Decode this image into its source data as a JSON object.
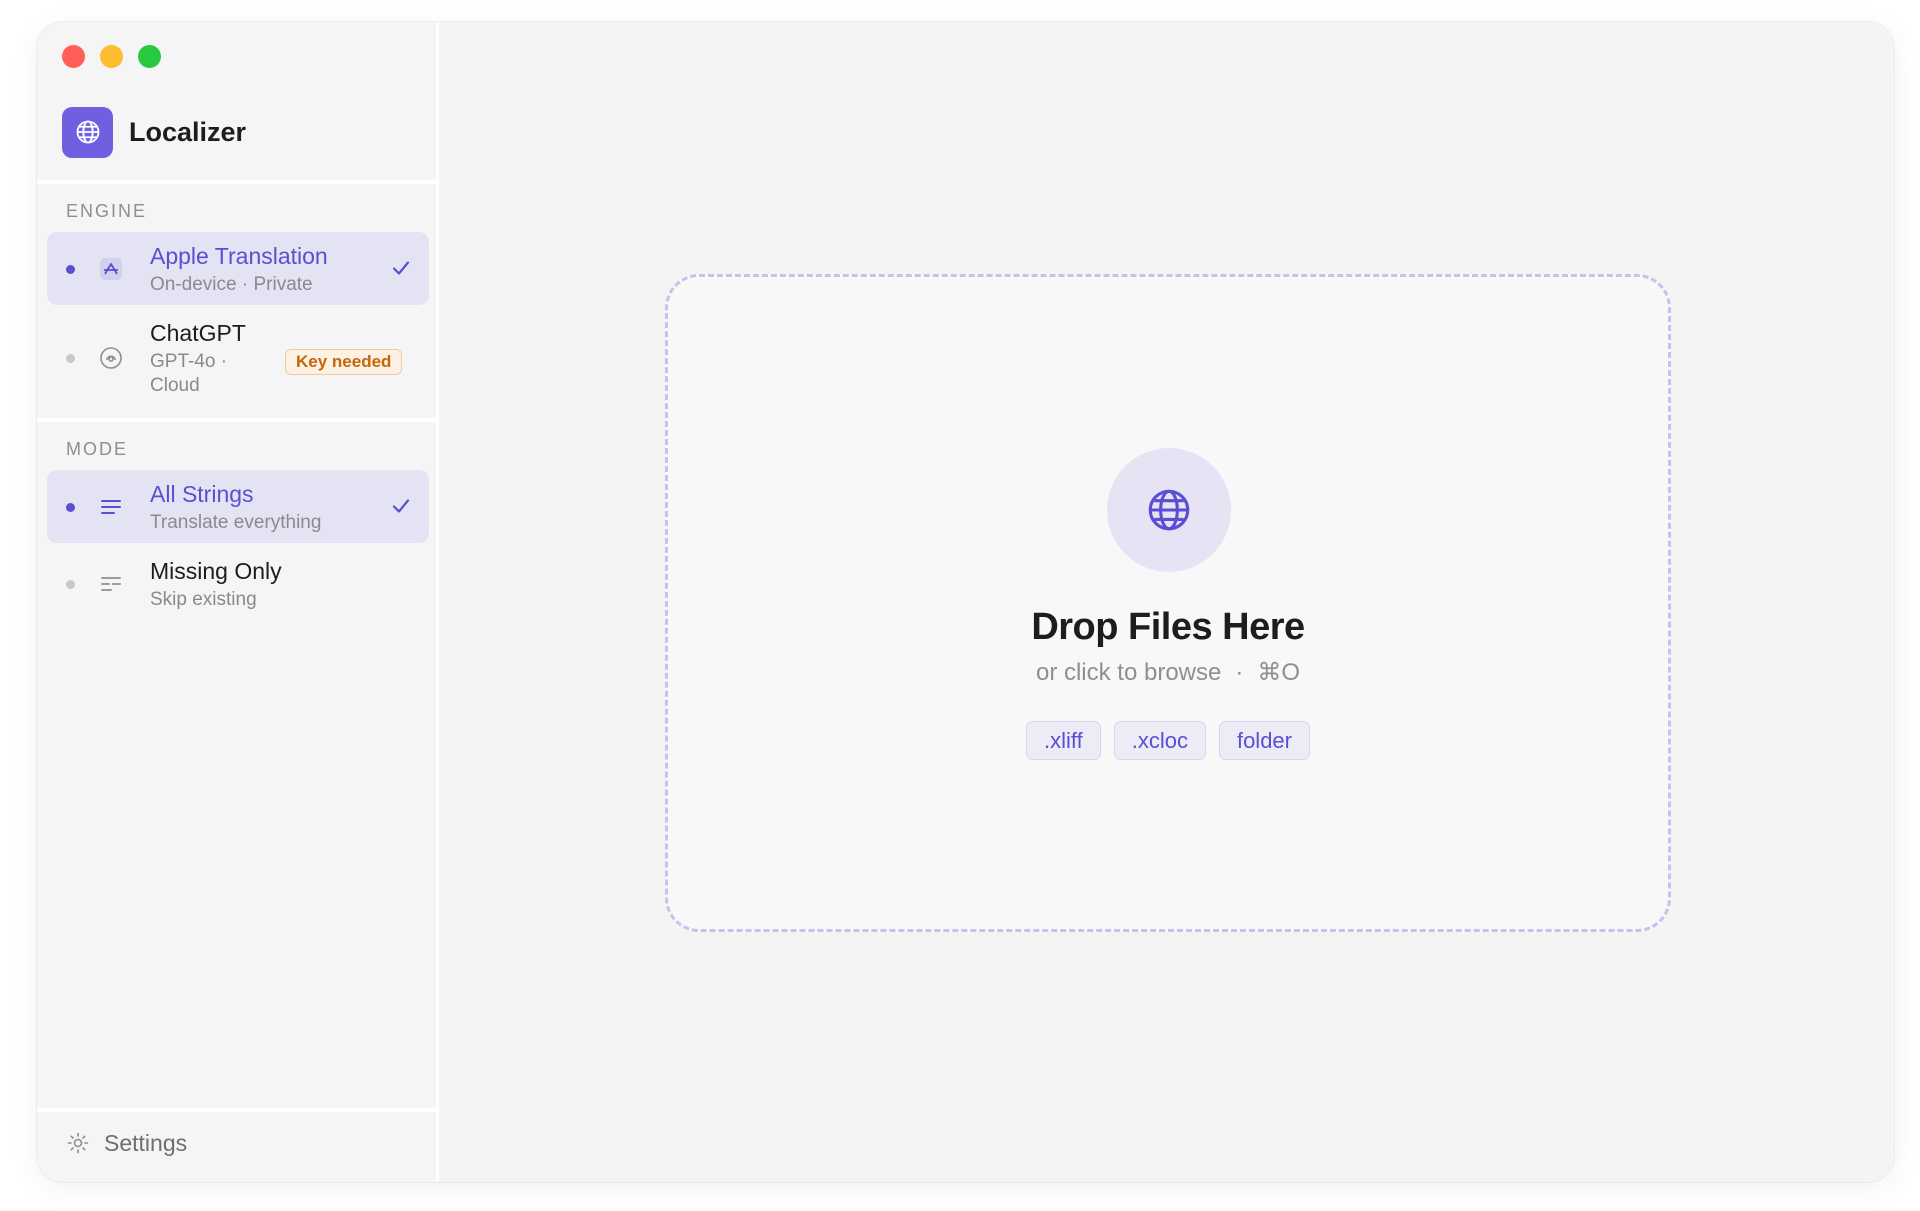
{
  "app": {
    "title": "Localizer",
    "accent": "#5a4fd3",
    "logo_bg": "#6e60e0"
  },
  "sidebar": {
    "engine": {
      "label": "ENGINE",
      "items": [
        {
          "title": "Apple Translation",
          "subtitle": "On-device · Private",
          "icon": "translate-icon",
          "selected": true
        },
        {
          "title": "ChatGPT",
          "subtitle_line1": "GPT-4o ·",
          "subtitle_line2": "Cloud",
          "icon": "openai-icon",
          "selected": false,
          "badge": "Key needed"
        }
      ]
    },
    "mode": {
      "label": "MODE",
      "items": [
        {
          "title": "All Strings",
          "subtitle": "Translate everything",
          "icon": "list-icon",
          "selected": true
        },
        {
          "title": "Missing Only",
          "subtitle": "Skip existing",
          "icon": "filter-list-icon",
          "selected": false
        }
      ]
    },
    "settings_label": "Settings"
  },
  "dropzone": {
    "title": "Drop Files Here",
    "subtitle": "or click to browse",
    "separator": "·",
    "shortcut": "⌘O",
    "chips": [
      ".xliff",
      ".xcloc",
      "folder"
    ]
  }
}
